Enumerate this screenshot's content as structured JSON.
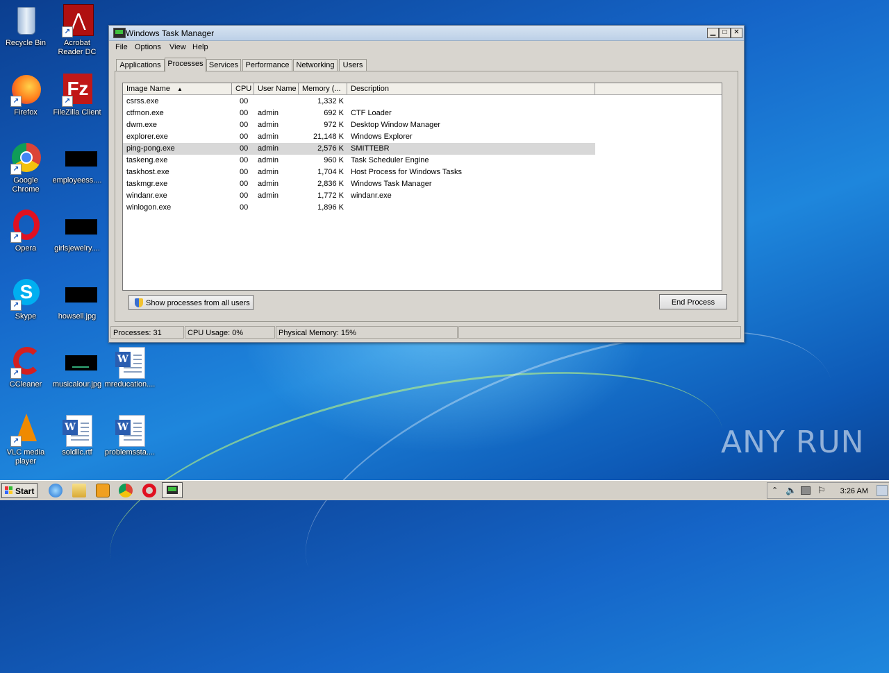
{
  "desktop": {
    "icons": [
      {
        "label": "Recycle Bin",
        "icon": "recycle-bin-icon"
      },
      {
        "label": "Acrobat Reader DC",
        "icon": "acrobat-icon"
      },
      {
        "label": "Firefox",
        "icon": "firefox-icon"
      },
      {
        "label": "FileZilla Client",
        "icon": "filezilla-icon"
      },
      {
        "label": "Google Chrome",
        "icon": "chrome-icon"
      },
      {
        "label": "employeess....",
        "icon": "image-thumbnail"
      },
      {
        "label": "Opera",
        "icon": "opera-icon"
      },
      {
        "label": "girlsjewelry....",
        "icon": "image-thumbnail"
      },
      {
        "label": "Skype",
        "icon": "skype-icon"
      },
      {
        "label": "howsell.jpg",
        "icon": "image-thumbnail"
      },
      {
        "label": "CCleaner",
        "icon": "ccleaner-icon"
      },
      {
        "label": "musicalour.jpg",
        "icon": "image-thumbnail"
      },
      {
        "label": "mreducation....",
        "icon": "word-doc-icon"
      },
      {
        "label": "VLC media player",
        "icon": "vlc-icon"
      },
      {
        "label": "soldllc.rtf",
        "icon": "word-doc-icon"
      },
      {
        "label": "problemssta....",
        "icon": "word-doc-icon"
      }
    ]
  },
  "window": {
    "title": "Windows Task Manager",
    "menu": [
      "File",
      "Options",
      "View",
      "Help"
    ],
    "tabs": [
      "Applications",
      "Processes",
      "Services",
      "Performance",
      "Networking",
      "Users"
    ],
    "active_tab": "Processes",
    "columns": [
      "Image Name",
      "CPU",
      "User Name",
      "Memory (...",
      "Description"
    ],
    "rows": [
      {
        "image": "csrss.exe",
        "cpu": "00",
        "user": "",
        "memory": "1,332 K",
        "desc": ""
      },
      {
        "image": "ctfmon.exe",
        "cpu": "00",
        "user": "admin",
        "memory": "692 K",
        "desc": "CTF Loader"
      },
      {
        "image": "dwm.exe",
        "cpu": "00",
        "user": "admin",
        "memory": "972 K",
        "desc": "Desktop Window Manager"
      },
      {
        "image": "explorer.exe",
        "cpu": "00",
        "user": "admin",
        "memory": "21,148 K",
        "desc": "Windows Explorer"
      },
      {
        "image": "ping-pong.exe",
        "cpu": "00",
        "user": "admin",
        "memory": "2,576 K",
        "desc": "SMITTEBR"
      },
      {
        "image": "taskeng.exe",
        "cpu": "00",
        "user": "admin",
        "memory": "960 K",
        "desc": "Task Scheduler Engine"
      },
      {
        "image": "taskhost.exe",
        "cpu": "00",
        "user": "admin",
        "memory": "1,704 K",
        "desc": "Host Process for Windows Tasks"
      },
      {
        "image": "taskmgr.exe",
        "cpu": "00",
        "user": "admin",
        "memory": "2,836 K",
        "desc": "Windows Task Manager"
      },
      {
        "image": "windanr.exe",
        "cpu": "00",
        "user": "admin",
        "memory": "1,772 K",
        "desc": "windanr.exe"
      },
      {
        "image": "winlogon.exe",
        "cpu": "00",
        "user": "",
        "memory": "1,896 K",
        "desc": ""
      }
    ],
    "selected_row": "ping-pong.exe",
    "show_all_label": "Show processes from all users",
    "end_process_label": "End Process",
    "status": {
      "processes": "Processes: 31",
      "cpu": "CPU Usage: 0%",
      "memory": "Physical Memory: 15%"
    }
  },
  "taskbar": {
    "start_label": "Start",
    "apps": [
      "ie-icon",
      "explorer-folder-icon",
      "media-player-icon",
      "chrome-icon",
      "opera-icon",
      "task-manager-icon"
    ],
    "clock": "3:26 AM"
  },
  "watermark": "ANY RUN"
}
